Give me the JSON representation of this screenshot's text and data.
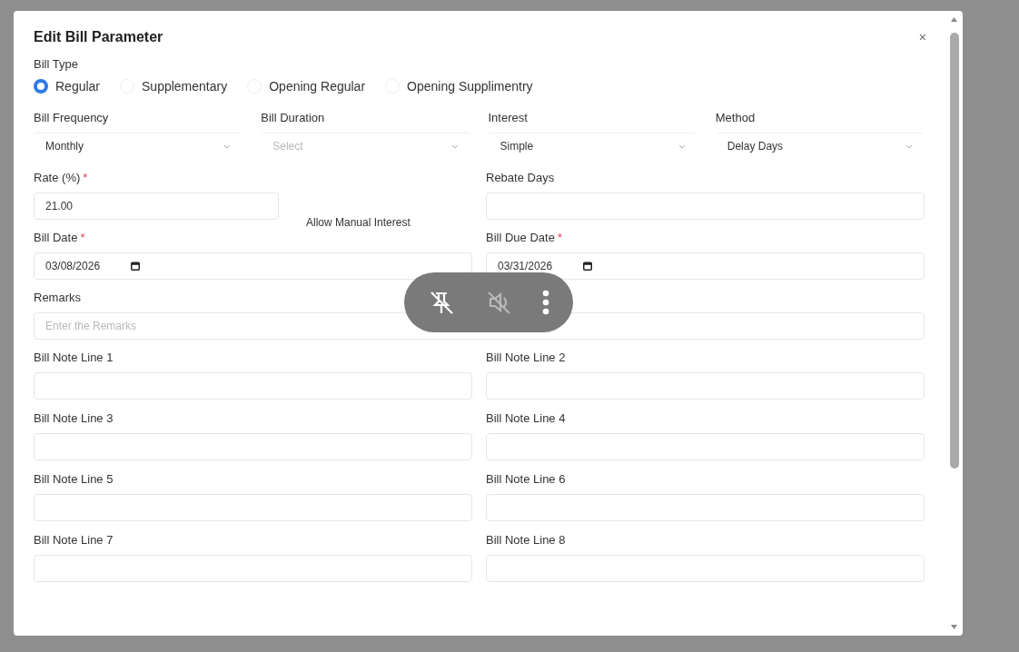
{
  "dialog": {
    "title": "Edit Bill Parameter",
    "close": "×"
  },
  "bill_type": {
    "label": "Bill Type",
    "options": [
      {
        "label": "Regular",
        "selected": true
      },
      {
        "label": "Supplementary",
        "selected": false
      },
      {
        "label": "Opening Regular",
        "selected": false
      },
      {
        "label": "Opening Supplimentry",
        "selected": false
      }
    ]
  },
  "row_1": [
    {
      "kind": "select",
      "label": "Bill Frequency",
      "value": "Monthly"
    },
    {
      "kind": "select",
      "label": "Bill Duration",
      "placeholder": "Select"
    },
    {
      "kind": "select",
      "label": "Interest",
      "value": "Simple"
    },
    {
      "kind": "select",
      "label": "Method",
      "value": "Delay Days"
    }
  ],
  "rate": {
    "kind": "text",
    "label": "Rate (%)",
    "required_mark": "*",
    "value": "21.00"
  },
  "allow_manual_interest": {
    "label": "Allow Manual Interest"
  },
  "rebate_days": {
    "kind": "text",
    "label": "Rebate Days"
  },
  "dates": [
    {
      "kind": "date",
      "label": "Bill Date",
      "required_mark": "*",
      "value": "03/08/2026"
    },
    {
      "kind": "date",
      "label": "Bill Due Date",
      "required_mark": "*",
      "value": "03/31/2026"
    }
  ],
  "remarks": {
    "kind": "text",
    "label": "Remarks",
    "placeholder": "Enter the Remarks"
  },
  "note_lines": [
    {
      "kind": "text",
      "label": "Bill Note Line 1"
    },
    {
      "kind": "text",
      "label": "Bill Note Line 2"
    },
    {
      "kind": "text",
      "label": "Bill Note Line 3"
    },
    {
      "kind": "text",
      "label": "Bill Note Line 4"
    },
    {
      "kind": "text",
      "label": "Bill Note Line 5"
    },
    {
      "kind": "text",
      "label": "Bill Note Line 6"
    },
    {
      "kind": "text",
      "label": "Bill Note Line 7"
    },
    {
      "kind": "text",
      "label": "Bill Note Line 8"
    }
  ]
}
